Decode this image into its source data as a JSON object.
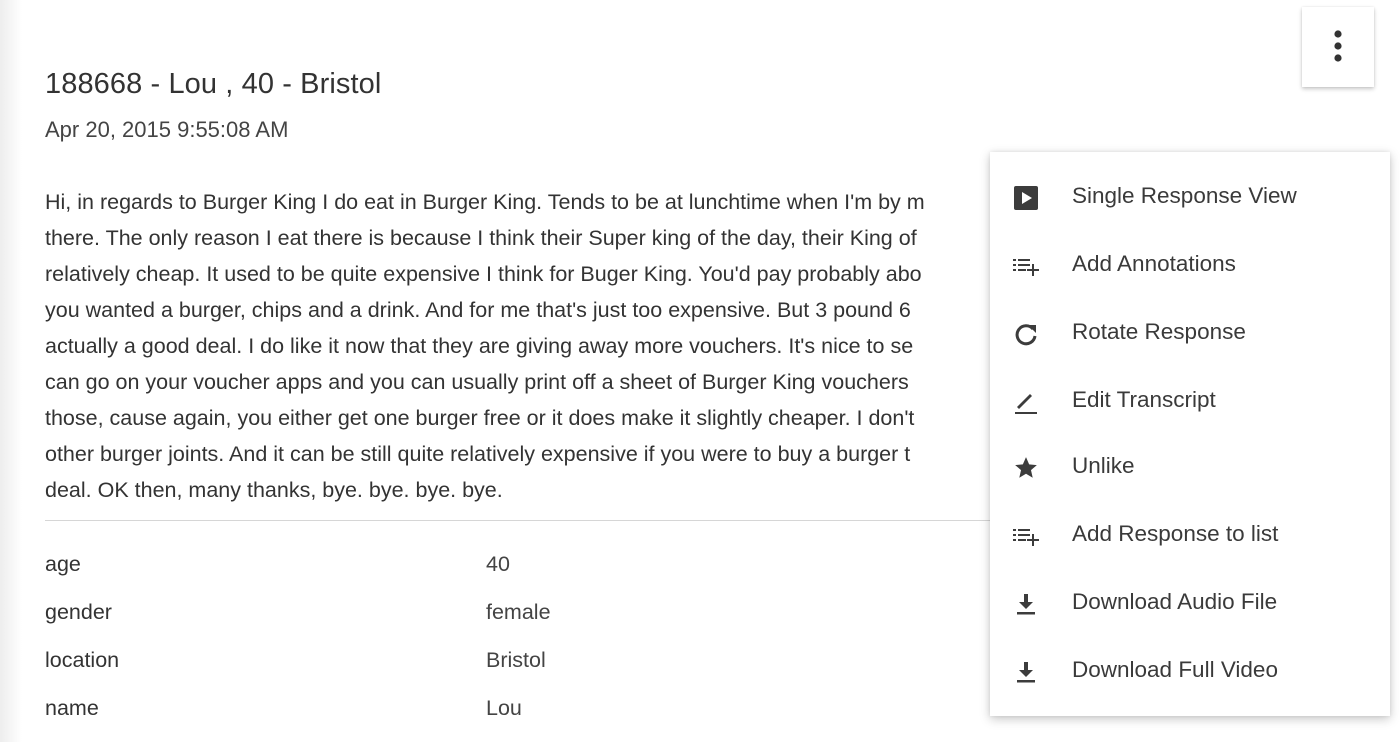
{
  "header": {
    "title": "188668 - Lou , 40 - Bristol",
    "date": "Apr 20, 2015 9:55:08 AM"
  },
  "transcript": {
    "lines": [
      "Hi, in regards to Burger King I do eat in Burger King. Tends to be at lunchtime when I'm by m",
      "there. The only reason I eat there is because I think their Super king of the day, their King of",
      "relatively cheap. It used to be quite expensive I think for Buger King. You'd pay probably abo",
      "you wanted a burger, chips and a drink. And for me that's just too expensive. But 3 pound 6",
      "actually a good deal. I do like it now that they are giving away more vouchers. It's nice to se",
      "can go on your voucher apps and you can usually print off a sheet of Burger King vouchers",
      "those, cause again, you either get one burger free or it does make it slightly cheaper. I don't",
      "other burger joints. And it can be still quite relatively expensive if you were to buy a burger t",
      "deal. OK then, many thanks, bye. bye. bye. bye."
    ]
  },
  "attributes": [
    {
      "key": "age",
      "value": "40"
    },
    {
      "key": "gender",
      "value": "female"
    },
    {
      "key": "location",
      "value": "Bristol"
    },
    {
      "key": "name",
      "value": "Lou"
    }
  ],
  "more_button": {
    "icon": "more-vert-icon"
  },
  "menu": {
    "items": [
      {
        "label": "Single Response View",
        "icon": "play-box-icon"
      },
      {
        "label": "Add Annotations",
        "icon": "playlist-add-icon"
      },
      {
        "label": "Rotate Response",
        "icon": "rotate-icon"
      },
      {
        "label": "Edit Transcript",
        "icon": "pencil-icon"
      },
      {
        "label": "Unlike",
        "icon": "star-icon"
      },
      {
        "label": "Add Response to list",
        "icon": "playlist-add-icon"
      },
      {
        "label": "Download Audio File",
        "icon": "download-icon"
      },
      {
        "label": "Download Full Video",
        "icon": "download-icon"
      }
    ]
  },
  "colors": {
    "text": "#333333",
    "icon": "#3c3c3c",
    "divider": "#d6d6d6"
  }
}
